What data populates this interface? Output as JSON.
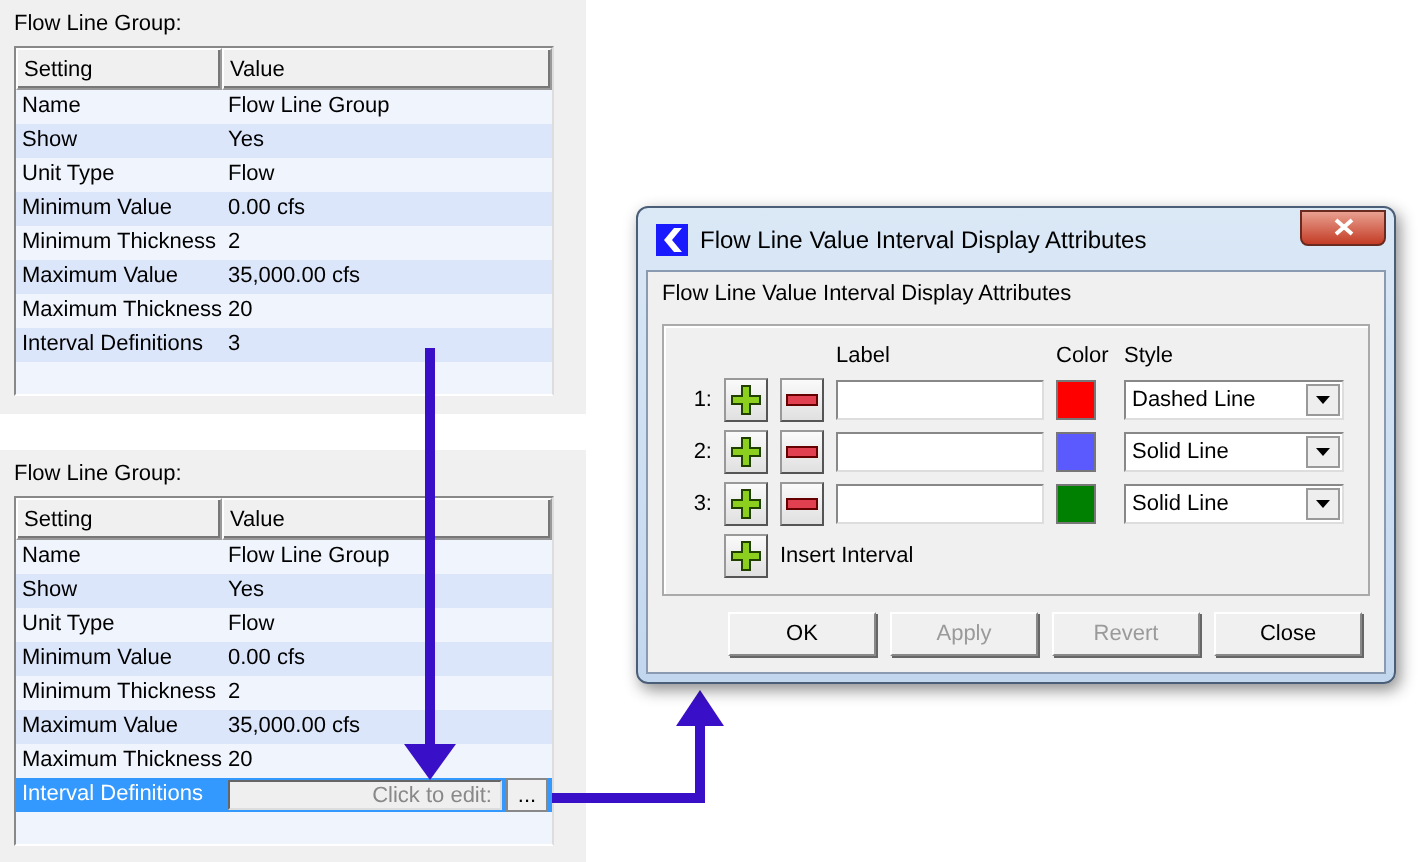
{
  "panels": [
    {
      "title": "Flow Line Group:",
      "columns": [
        "Setting",
        "Value"
      ],
      "rows": [
        {
          "setting": "Name",
          "value": "Flow Line Group",
          "selected": false
        },
        {
          "setting": "Show",
          "value": "Yes",
          "selected": false
        },
        {
          "setting": "Unit Type",
          "value": "Flow",
          "selected": false
        },
        {
          "setting": "Minimum Value",
          "value": "0.00 cfs",
          "selected": false
        },
        {
          "setting": "Minimum Thickness",
          "value": "2",
          "selected": false
        },
        {
          "setting": "Maximum Value",
          "value": "35,000.00 cfs",
          "selected": false
        },
        {
          "setting": "Maximum Thickness",
          "value": "20",
          "selected": false
        },
        {
          "setting": "Interval Definitions",
          "value": "3",
          "selected": false
        }
      ]
    },
    {
      "title": "Flow Line Group:",
      "columns": [
        "Setting",
        "Value"
      ],
      "rows": [
        {
          "setting": "Name",
          "value": "Flow Line Group",
          "selected": false
        },
        {
          "setting": "Show",
          "value": "Yes",
          "selected": false
        },
        {
          "setting": "Unit Type",
          "value": "Flow",
          "selected": false
        },
        {
          "setting": "Minimum Value",
          "value": "0.00 cfs",
          "selected": false
        },
        {
          "setting": "Minimum Thickness",
          "value": "2",
          "selected": false
        },
        {
          "setting": "Maximum Value",
          "value": "35,000.00 cfs",
          "selected": false
        },
        {
          "setting": "Maximum Thickness",
          "value": "20",
          "selected": false
        },
        {
          "setting": "Interval Definitions",
          "placeholder": "Click to edit:",
          "editor_button": "...",
          "selected": true
        }
      ]
    }
  ],
  "dialog": {
    "title": "Flow Line Value Interval Display Attributes",
    "heading": "Flow Line Value Interval Display Attributes",
    "columns": [
      "Label",
      "Color",
      "Style"
    ],
    "intervals": [
      {
        "number": "1:",
        "color": "#ff0000",
        "style": "Dashed Line"
      },
      {
        "number": "2:",
        "color": "#5a5aff",
        "style": "Solid Line"
      },
      {
        "number": "3:",
        "color": "#008000",
        "style": "Solid Line"
      }
    ],
    "insert_label": "Insert Interval",
    "buttons": [
      {
        "label": "OK",
        "disabled": false
      },
      {
        "label": "Apply",
        "disabled": true
      },
      {
        "label": "Revert",
        "disabled": true
      },
      {
        "label": "Close",
        "disabled": false
      }
    ]
  }
}
